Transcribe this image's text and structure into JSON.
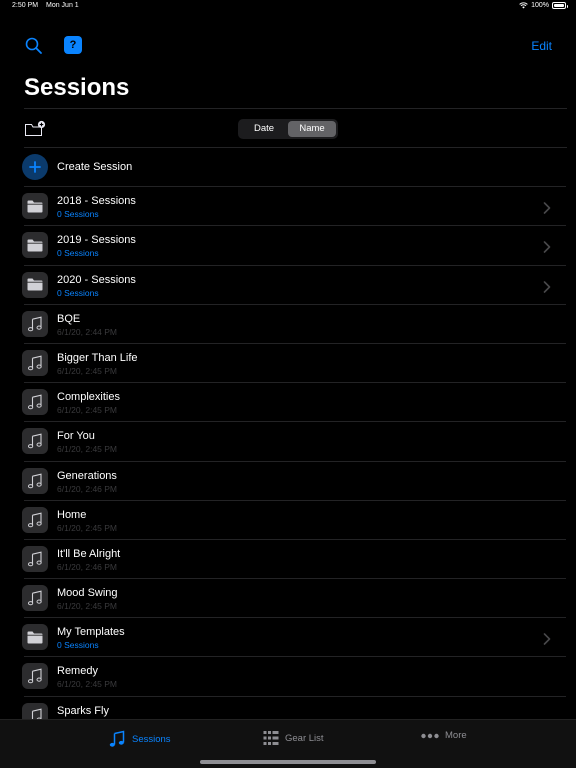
{
  "status_bar": {
    "time": "2:50 PM",
    "date": "Mon Jun 1",
    "battery": "100%"
  },
  "nav": {
    "edit_label": "Edit",
    "help_label": "?"
  },
  "page": {
    "title": "Sessions"
  },
  "sort": {
    "options": [
      "Date",
      "Name"
    ],
    "selected": "Name"
  },
  "create": {
    "label": "Create Session"
  },
  "items": [
    {
      "type": "folder",
      "title": "2018 - Sessions",
      "subtitle": "0 Sessions"
    },
    {
      "type": "folder",
      "title": "2019 - Sessions",
      "subtitle": "0 Sessions"
    },
    {
      "type": "folder",
      "title": "2020 - Sessions",
      "subtitle": "0 Sessions"
    },
    {
      "type": "session",
      "title": "BQE",
      "subtitle": "6/1/20, 2:44 PM"
    },
    {
      "type": "session",
      "title": "Bigger Than Life",
      "subtitle": "6/1/20, 2:45 PM"
    },
    {
      "type": "session",
      "title": "Complexities",
      "subtitle": "6/1/20, 2:45 PM"
    },
    {
      "type": "session",
      "title": "For You",
      "subtitle": "6/1/20, 2:45 PM"
    },
    {
      "type": "session",
      "title": "Generations",
      "subtitle": "6/1/20, 2:46 PM"
    },
    {
      "type": "session",
      "title": "Home",
      "subtitle": "6/1/20, 2:45 PM"
    },
    {
      "type": "session",
      "title": "It'll Be Alright",
      "subtitle": "6/1/20, 2:46 PM"
    },
    {
      "type": "session",
      "title": "Mood Swing",
      "subtitle": "6/1/20, 2:45 PM"
    },
    {
      "type": "folder",
      "title": "My Templates",
      "subtitle": "0 Sessions"
    },
    {
      "type": "session",
      "title": "Remedy",
      "subtitle": "6/1/20, 2:45 PM"
    },
    {
      "type": "session",
      "title": "Sparks Fly",
      "subtitle": ""
    }
  ],
  "tabs": {
    "sessions": "Sessions",
    "gear_list": "Gear List",
    "more": "More"
  },
  "colors": {
    "accent": "#0a84ff",
    "background": "#000000",
    "cell": "#2c2c2e"
  }
}
